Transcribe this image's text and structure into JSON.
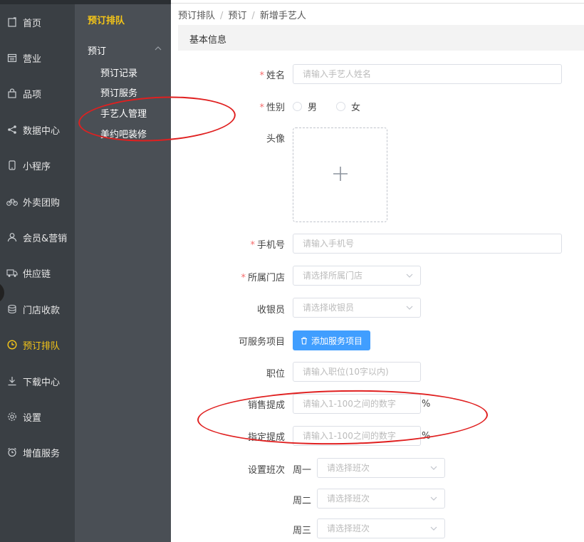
{
  "sidebar": {
    "items": [
      {
        "label": "首页",
        "icon": "home-icon"
      },
      {
        "label": "营业",
        "icon": "calendar-icon"
      },
      {
        "label": "品项",
        "icon": "bag-icon"
      },
      {
        "label": "数据中心",
        "icon": "share-icon"
      },
      {
        "label": "小程序",
        "icon": "phone-icon"
      },
      {
        "label": "外卖团购",
        "icon": "bike-icon"
      },
      {
        "label": "会员&营销",
        "icon": "user-icon"
      },
      {
        "label": "供应链",
        "icon": "truck-icon"
      },
      {
        "label": "门店收款",
        "icon": "coins-icon"
      },
      {
        "label": "预订排队",
        "icon": "clock-icon"
      },
      {
        "label": "下载中心",
        "icon": "download-icon"
      },
      {
        "label": "设置",
        "icon": "gear-icon"
      },
      {
        "label": "增值服务",
        "icon": "alarm-icon"
      }
    ],
    "active_index": 9
  },
  "subnav": {
    "title": "预订排队",
    "group": "预订",
    "links": [
      "预订记录",
      "预订服务",
      "手艺人管理",
      "美约吧装修"
    ]
  },
  "breadcrumb": [
    "预订排队",
    "预订",
    "新增手艺人"
  ],
  "breadcrumb_sep": "/",
  "section_title": "基本信息",
  "form": {
    "required_mark": "*",
    "name": {
      "label": "姓名",
      "placeholder": "请输入手艺人姓名"
    },
    "gender": {
      "label": "性别",
      "options": [
        "男",
        "女"
      ]
    },
    "avatar": {
      "label": "头像",
      "plus": "+"
    },
    "phone": {
      "label": "手机号",
      "placeholder": "请输入手机号"
    },
    "store": {
      "label": "所属门店",
      "placeholder": "请选择所属门店"
    },
    "cashier": {
      "label": "收银员",
      "placeholder": "请选择收银员"
    },
    "services": {
      "label": "可服务项目",
      "button": "添加服务项目"
    },
    "position": {
      "label": "职位",
      "placeholder": "请输入职位(10字以内)"
    },
    "sales_commission": {
      "label": "销售提成",
      "placeholder": "请输入1-100之间的数字",
      "suffix": "%"
    },
    "assigned_commission": {
      "label": "指定提成",
      "placeholder": "请输入1-100之间的数字",
      "suffix": "%"
    },
    "shift": {
      "label": "设置班次",
      "days": [
        "周一",
        "周二",
        "周三"
      ],
      "placeholder": "请选择班次"
    }
  },
  "colors": {
    "annotation": "#e02020",
    "accent": "#f5c518",
    "primary": "#409eff"
  }
}
